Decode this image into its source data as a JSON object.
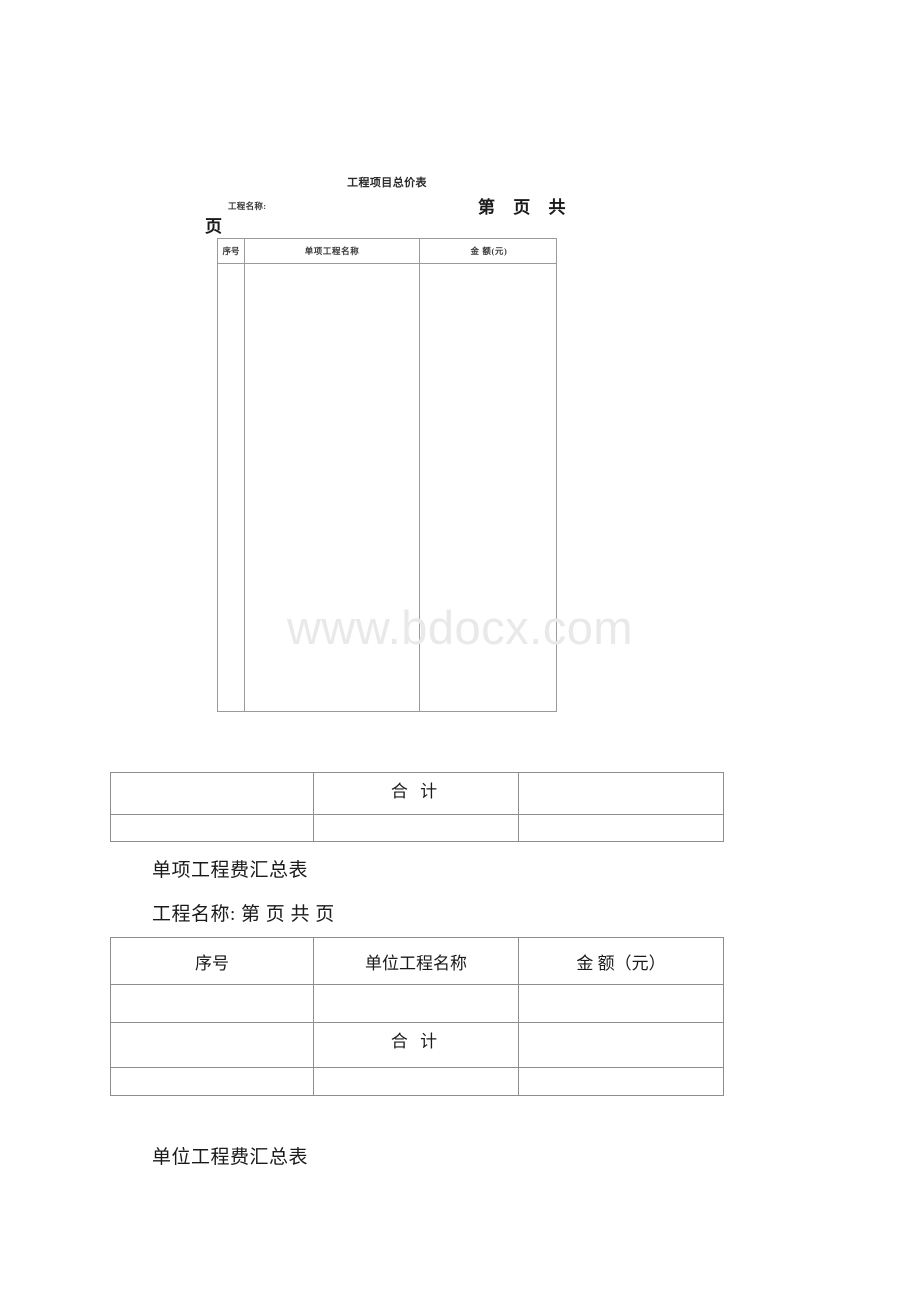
{
  "document": {
    "watermark": "www.bdocx.com"
  },
  "section1": {
    "title": "工程项目总价表",
    "project_name_label": "工程名称:",
    "page_info": "第  页  共",
    "page_info_wrap": "页",
    "table": {
      "headers": [
        "序号",
        "单项工程名称",
        "金  额(元)"
      ]
    }
  },
  "section2": {
    "table": {
      "rows": [
        [
          "",
          "合 计",
          ""
        ],
        [
          "",
          "",
          ""
        ]
      ]
    }
  },
  "section3": {
    "heading": "单项工程费汇总表",
    "project_line": "工程名称: 第 页 共 页",
    "table": {
      "headers": [
        "序号",
        "单位工程名称",
        "金 额（元）"
      ],
      "rows": [
        [
          "",
          "",
          ""
        ],
        [
          "",
          "合 计",
          ""
        ],
        [
          "",
          "",
          ""
        ]
      ]
    }
  },
  "section4": {
    "heading": "单位工程费汇总表"
  }
}
